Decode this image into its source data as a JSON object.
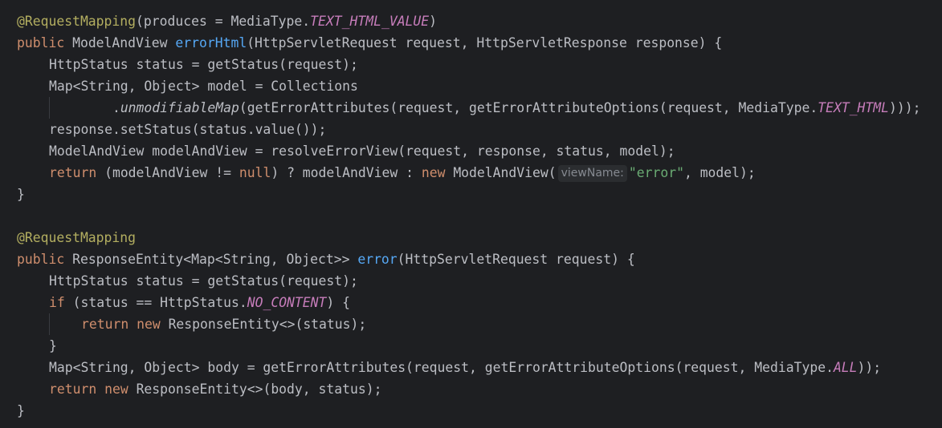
{
  "editor": {
    "language": "java",
    "colors": {
      "background": "#1e1f22",
      "text": "#bcbec4",
      "keyword": "#cf8e6d",
      "annotation": "#b3ae60",
      "function": "#56a8f5",
      "constant": "#c77dbb",
      "string": "#6aab73",
      "inlay_hint": "#868a91"
    },
    "lines": [
      {
        "indent": 0,
        "tokens": [
          {
            "t": "ann",
            "v": "@RequestMapping"
          },
          {
            "t": "plain",
            "v": "(produces = MediaType."
          },
          {
            "t": "const",
            "v": "TEXT_HTML_VALUE"
          },
          {
            "t": "plain",
            "v": ")"
          }
        ]
      },
      {
        "indent": 0,
        "tokens": [
          {
            "t": "kw",
            "v": "public "
          },
          {
            "t": "plain",
            "v": "ModelAndView "
          },
          {
            "t": "fn",
            "v": "errorHtml"
          },
          {
            "t": "plain",
            "v": "(HttpServletRequest request, HttpServletResponse response) {"
          }
        ]
      },
      {
        "indent": 1,
        "tokens": [
          {
            "t": "plain",
            "v": "HttpStatus status = getStatus(request);"
          }
        ]
      },
      {
        "indent": 1,
        "tokens": [
          {
            "t": "plain",
            "v": "Map<String, Object> model = Collections"
          }
        ]
      },
      {
        "indent": 1,
        "extra_guide": true,
        "tokens": [
          {
            "t": "plain",
            "v": "        ."
          },
          {
            "t": "stat",
            "v": "unmodifiableMap"
          },
          {
            "t": "plain",
            "v": "(getErrorAttributes(request, getErrorAttributeOptions(request, MediaType."
          },
          {
            "t": "const",
            "v": "TEXT_HTML"
          },
          {
            "t": "plain",
            "v": ")));"
          }
        ]
      },
      {
        "indent": 1,
        "tokens": [
          {
            "t": "plain",
            "v": "response.setStatus(status.value());"
          }
        ]
      },
      {
        "indent": 1,
        "tokens": [
          {
            "t": "plain",
            "v": "ModelAndView modelAndView = resolveErrorView(request, response, status, model);"
          }
        ]
      },
      {
        "indent": 1,
        "tokens": [
          {
            "t": "kw",
            "v": "return "
          },
          {
            "t": "plain",
            "v": "(modelAndView != "
          },
          {
            "t": "kw",
            "v": "null"
          },
          {
            "t": "plain",
            "v": ") ? modelAndView : "
          },
          {
            "t": "kw",
            "v": "new "
          },
          {
            "t": "plain",
            "v": "ModelAndView("
          },
          {
            "t": "hint",
            "v": "viewName:"
          },
          {
            "t": "str",
            "v": "\"error\""
          },
          {
            "t": "plain",
            "v": ", model);"
          }
        ]
      },
      {
        "indent": 0,
        "tokens": [
          {
            "t": "plain",
            "v": "}"
          }
        ]
      },
      {
        "indent": 0,
        "tokens": []
      },
      {
        "indent": 0,
        "tokens": [
          {
            "t": "ann",
            "v": "@RequestMapping"
          }
        ]
      },
      {
        "indent": 0,
        "tokens": [
          {
            "t": "kw",
            "v": "public "
          },
          {
            "t": "plain",
            "v": "ResponseEntity<Map<String, Object>> "
          },
          {
            "t": "fn",
            "v": "error"
          },
          {
            "t": "plain",
            "v": "(HttpServletRequest request) {"
          }
        ]
      },
      {
        "indent": 1,
        "tokens": [
          {
            "t": "plain",
            "v": "HttpStatus status = getStatus(request);"
          }
        ]
      },
      {
        "indent": 1,
        "tokens": [
          {
            "t": "kw",
            "v": "if "
          },
          {
            "t": "plain",
            "v": "(status == HttpStatus."
          },
          {
            "t": "const",
            "v": "NO_CONTENT"
          },
          {
            "t": "plain",
            "v": ") {"
          }
        ]
      },
      {
        "indent": 2,
        "tokens": [
          {
            "t": "kw",
            "v": "return "
          },
          {
            "t": "kw",
            "v": "new "
          },
          {
            "t": "plain",
            "v": "ResponseEntity<>(status);"
          }
        ]
      },
      {
        "indent": 1,
        "tokens": [
          {
            "t": "plain",
            "v": "}"
          }
        ]
      },
      {
        "indent": 1,
        "tokens": [
          {
            "t": "plain",
            "v": "Map<String, Object> body = getErrorAttributes(request, getErrorAttributeOptions(request, MediaType."
          },
          {
            "t": "const",
            "v": "ALL"
          },
          {
            "t": "plain",
            "v": "));"
          }
        ]
      },
      {
        "indent": 1,
        "tokens": [
          {
            "t": "kw",
            "v": "return "
          },
          {
            "t": "kw",
            "v": "new "
          },
          {
            "t": "plain",
            "v": "ResponseEntity<>(body, status);"
          }
        ]
      },
      {
        "indent": 0,
        "tokens": [
          {
            "t": "plain",
            "v": "}"
          }
        ]
      }
    ]
  }
}
